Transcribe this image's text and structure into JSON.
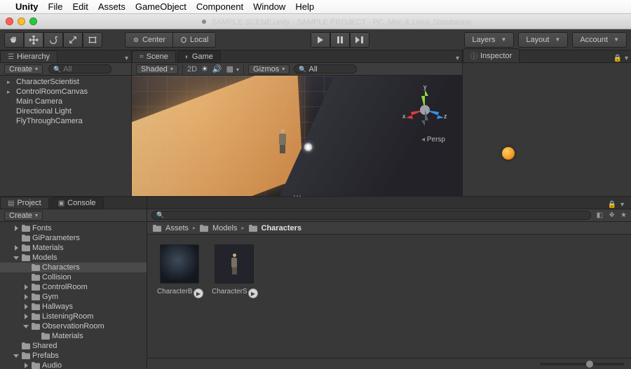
{
  "mac_menu": {
    "items": [
      "Unity",
      "File",
      "Edit",
      "Assets",
      "GameObject",
      "Component",
      "Window",
      "Help"
    ]
  },
  "window": {
    "title": "SAMPLE SCENE.unity - SAMPLE PROJECT - PC, Mac & Linux Standalone"
  },
  "toolbar": {
    "pivot_center": "Center",
    "pivot_local": "Local",
    "layers": "Layers",
    "layout": "Layout",
    "account": "Account"
  },
  "hierarchy": {
    "tab": "Hierarchy",
    "create": "Create",
    "search_placeholder": "All",
    "items": [
      {
        "label": "CharacterScientist",
        "link": true,
        "expand": true
      },
      {
        "label": "ControlRoomCanvas",
        "link": true,
        "expand": true
      },
      {
        "label": "Main Camera",
        "link": false
      },
      {
        "label": "Directional Light",
        "link": false
      },
      {
        "label": "FlyThroughCamera",
        "link": true
      }
    ]
  },
  "scene": {
    "tab_scene": "Scene",
    "tab_game": "Game",
    "shading": "Shaded",
    "toggle_2d": "2D",
    "gizmos": "Gizmos",
    "search_placeholder": "All",
    "axes": {
      "x": "x",
      "y": "y",
      "z": "z"
    },
    "persp": "Persp"
  },
  "inspector": {
    "tab": "Inspector"
  },
  "project": {
    "tab_project": "Project",
    "tab_console": "Console",
    "create": "Create",
    "search_placeholder": "",
    "tree": [
      {
        "label": "Fonts",
        "depth": 1,
        "expand": "right"
      },
      {
        "label": "GiParameters",
        "depth": 1
      },
      {
        "label": "Materials",
        "depth": 1,
        "expand": "right"
      },
      {
        "label": "Models",
        "depth": 1,
        "expand": "down"
      },
      {
        "label": "Characters",
        "depth": 2,
        "selected": true
      },
      {
        "label": "Collision",
        "depth": 2
      },
      {
        "label": "ControlRoom",
        "depth": 2,
        "expand": "right"
      },
      {
        "label": "Gym",
        "depth": 2,
        "expand": "right"
      },
      {
        "label": "Hallways",
        "depth": 2,
        "expand": "right"
      },
      {
        "label": "ListeningRoom",
        "depth": 2,
        "expand": "right"
      },
      {
        "label": "ObservationRoom",
        "depth": 2,
        "expand": "down"
      },
      {
        "label": "Materials",
        "depth": 3
      },
      {
        "label": "Shared",
        "depth": 1
      },
      {
        "label": "Prefabs",
        "depth": 1,
        "expand": "down"
      },
      {
        "label": "Audio",
        "depth": 2,
        "expand": "right"
      }
    ],
    "breadcrumb": [
      "Assets",
      "Models",
      "Characters"
    ],
    "thumbs": [
      {
        "label": "CharacterBu..."
      },
      {
        "label": "CharacterSci..."
      }
    ]
  }
}
